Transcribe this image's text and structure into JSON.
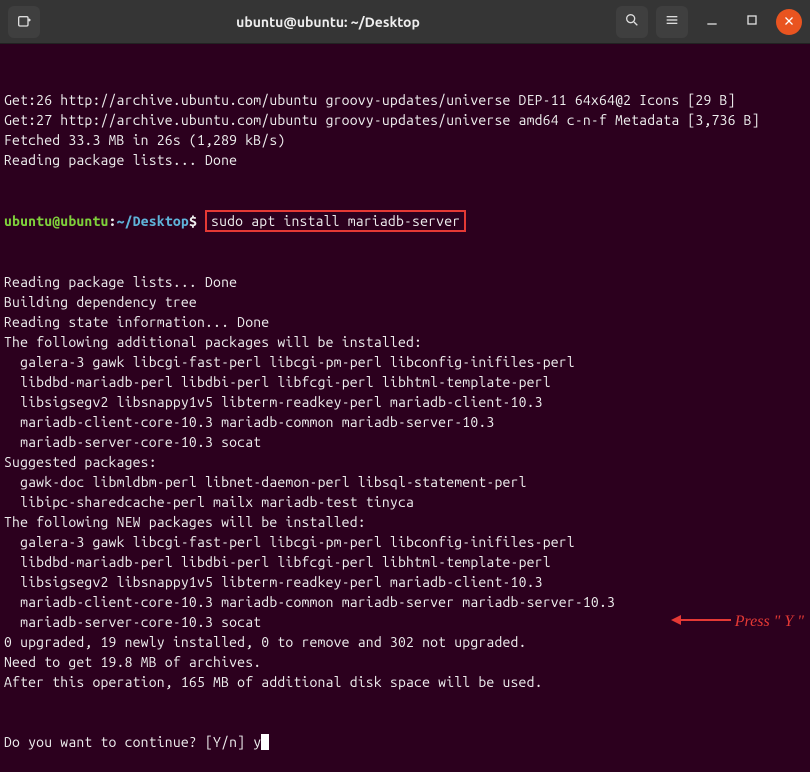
{
  "window": {
    "title": "ubuntu@ubuntu: ~/Desktop"
  },
  "prompt": {
    "user": "ubuntu@ubuntu",
    "sep": ":",
    "path": "~/Desktop",
    "sigil": "$"
  },
  "command": "sudo apt install mariadb-server",
  "input_answer": "y",
  "annotation_text": "Press \" Y \"",
  "output": {
    "pre": [
      "Get:26 http://archive.ubuntu.com/ubuntu groovy-updates/universe DEP-11 64x64@2 Icons [29 B]",
      "Get:27 http://archive.ubuntu.com/ubuntu groovy-updates/universe amd64 c-n-f Metadata [3,736 B]",
      "Fetched 33.3 MB in 26s (1,289 kB/s)",
      "Reading package lists... Done"
    ],
    "post": [
      "Reading package lists... Done",
      "Building dependency tree",
      "Reading state information... Done",
      "The following additional packages will be installed:",
      "  galera-3 gawk libcgi-fast-perl libcgi-pm-perl libconfig-inifiles-perl",
      "  libdbd-mariadb-perl libdbi-perl libfcgi-perl libhtml-template-perl",
      "  libsigsegv2 libsnappy1v5 libterm-readkey-perl mariadb-client-10.3",
      "  mariadb-client-core-10.3 mariadb-common mariadb-server-10.3",
      "  mariadb-server-core-10.3 socat",
      "Suggested packages:",
      "  gawk-doc libmldbm-perl libnet-daemon-perl libsql-statement-perl",
      "  libipc-sharedcache-perl mailx mariadb-test tinyca",
      "The following NEW packages will be installed:",
      "  galera-3 gawk libcgi-fast-perl libcgi-pm-perl libconfig-inifiles-perl",
      "  libdbd-mariadb-perl libdbi-perl libfcgi-perl libhtml-template-perl",
      "  libsigsegv2 libsnappy1v5 libterm-readkey-perl mariadb-client-10.3",
      "  mariadb-client-core-10.3 mariadb-common mariadb-server mariadb-server-10.3",
      "  mariadb-server-core-10.3 socat",
      "0 upgraded, 19 newly installed, 0 to remove and 302 not upgraded.",
      "Need to get 19.8 MB of archives.",
      "After this operation, 165 MB of additional disk space will be used."
    ],
    "question": "Do you want to continue? [Y/n] "
  }
}
